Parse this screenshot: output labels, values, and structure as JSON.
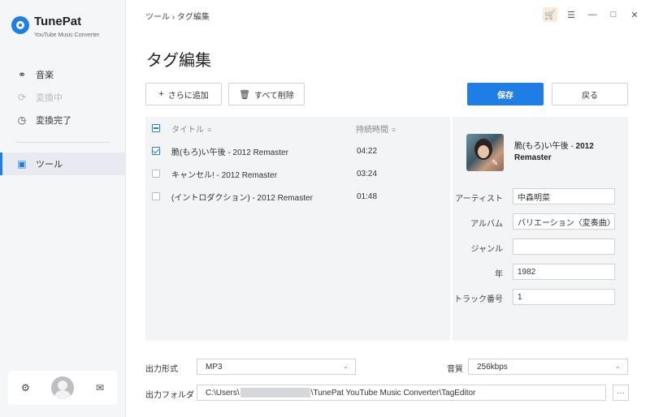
{
  "app": {
    "name": "TunePat",
    "subtitle": "YouTube Music Converter"
  },
  "sidebar": {
    "items": [
      {
        "label": "音楽",
        "icon": "headphones-icon"
      },
      {
        "label": "変換中",
        "icon": "sync-icon"
      },
      {
        "label": "変換完了",
        "icon": "clock-icon"
      },
      {
        "label": "ツール",
        "icon": "toolbox-icon"
      }
    ]
  },
  "breadcrumb": "ツール › タグ編集",
  "page_title": "タグ編集",
  "toolbar": {
    "add_label": "さらに追加",
    "delete_all_label": "すべて削除",
    "save_label": "保存",
    "back_label": "戻る"
  },
  "table": {
    "columns": [
      "タイトル",
      "持続時間"
    ],
    "rows": [
      {
        "title": "脆(もろ)い午後 - 2012 Remaster",
        "duration": "04:22",
        "checked": true
      },
      {
        "title": "キャンセル! - 2012 Remaster",
        "duration": "03:24",
        "checked": false
      },
      {
        "title": "(イントロダクション) - 2012 Remaster",
        "duration": "01:48",
        "checked": false
      }
    ]
  },
  "detail": {
    "song_title_plain": "脆(もろ)い午後 - ",
    "song_title_bold": "2012 Remaster",
    "fields": [
      {
        "label": "アーティスト",
        "value": "中森明菜"
      },
      {
        "label": "アルバム",
        "value": "バリエーション〈変奏曲〉"
      },
      {
        "label": "ジャンル",
        "value": ""
      },
      {
        "label": "年",
        "value": "1982"
      },
      {
        "label": "トラック番号",
        "value": "1"
      }
    ]
  },
  "settings": {
    "format_label": "出力形式",
    "format_value": "MP3",
    "quality_label": "音質",
    "quality_value": "256kbps",
    "folder_label": "出力フォルダ",
    "folder_prefix": "C:\\Users\\",
    "folder_suffix": "\\TunePat YouTube Music Converter\\TagEditor",
    "browse_label": "···"
  },
  "colors": {
    "accent": "#1f7de6",
    "cart": "#e88a3a"
  }
}
